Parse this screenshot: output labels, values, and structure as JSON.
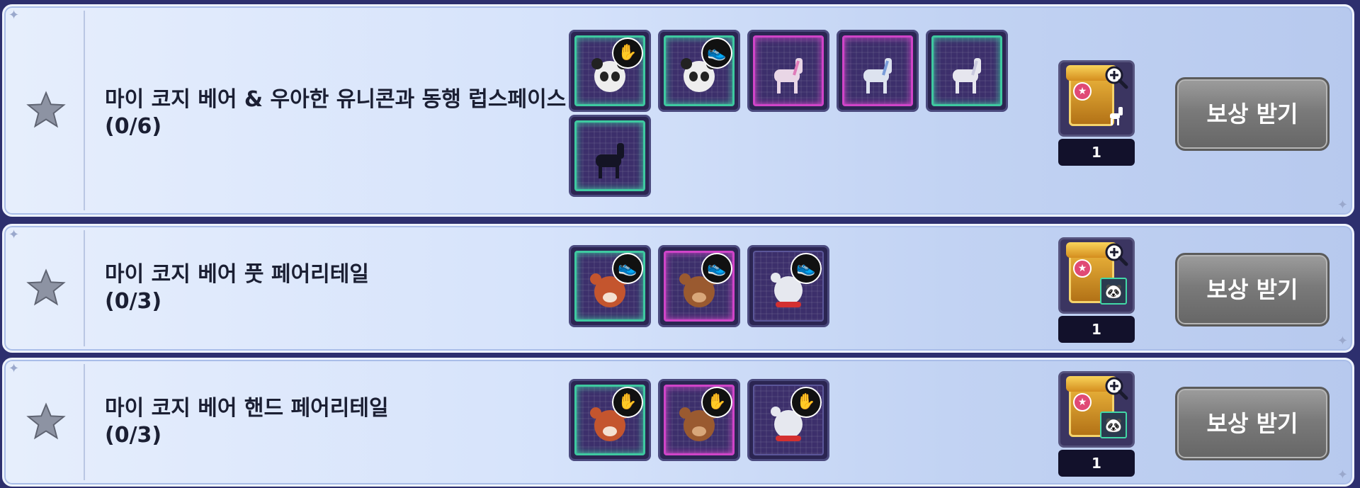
{
  "missions": [
    {
      "title": "마이 코지 베어 & 우아한 유니콘과 동행 럽스페이스",
      "count": "(0/6)",
      "items": [
        {
          "icon": "panda-icon",
          "frame": "green",
          "badge": "gloves-icon"
        },
        {
          "icon": "panda-icon",
          "frame": "green",
          "badge": "shoes-icon"
        },
        {
          "icon": "unicorn-icon",
          "frame": "pink",
          "badge": ""
        },
        {
          "icon": "unicorn-icon",
          "frame": "pink",
          "badge": ""
        },
        {
          "icon": "unicorn-icon",
          "frame": "green",
          "badge": ""
        },
        {
          "icon": "black-horse-icon",
          "frame": "green",
          "badge": ""
        }
      ],
      "reward_qty": "1",
      "claim_label": "보상 받기"
    },
    {
      "title": "마이 코지 베어 풋 페어리테일",
      "count": "(0/3)",
      "items": [
        {
          "icon": "red-panda-icon",
          "frame": "green",
          "badge": "shoes-icon"
        },
        {
          "icon": "brown-bear-icon",
          "frame": "pink",
          "badge": "shoes-icon"
        },
        {
          "icon": "polar-bear-icon",
          "frame": "dark",
          "badge": "shoes-icon"
        }
      ],
      "reward_qty": "1",
      "claim_label": "보상 받기"
    },
    {
      "title": "마이 코지 베어 핸드 페어리테일",
      "count": "(0/3)",
      "items": [
        {
          "icon": "red-panda-icon",
          "frame": "green",
          "badge": "gloves-icon"
        },
        {
          "icon": "brown-bear-icon",
          "frame": "pink",
          "badge": "gloves-icon"
        },
        {
          "icon": "polar-bear-icon",
          "frame": "dark",
          "badge": "gloves-icon"
        }
      ],
      "reward_qty": "1",
      "claim_label": "보상 받기"
    }
  ],
  "colors": {
    "frame_green": "#3ec9a0",
    "frame_pink": "#d044c8",
    "button_gray": "#7a7a7a"
  }
}
